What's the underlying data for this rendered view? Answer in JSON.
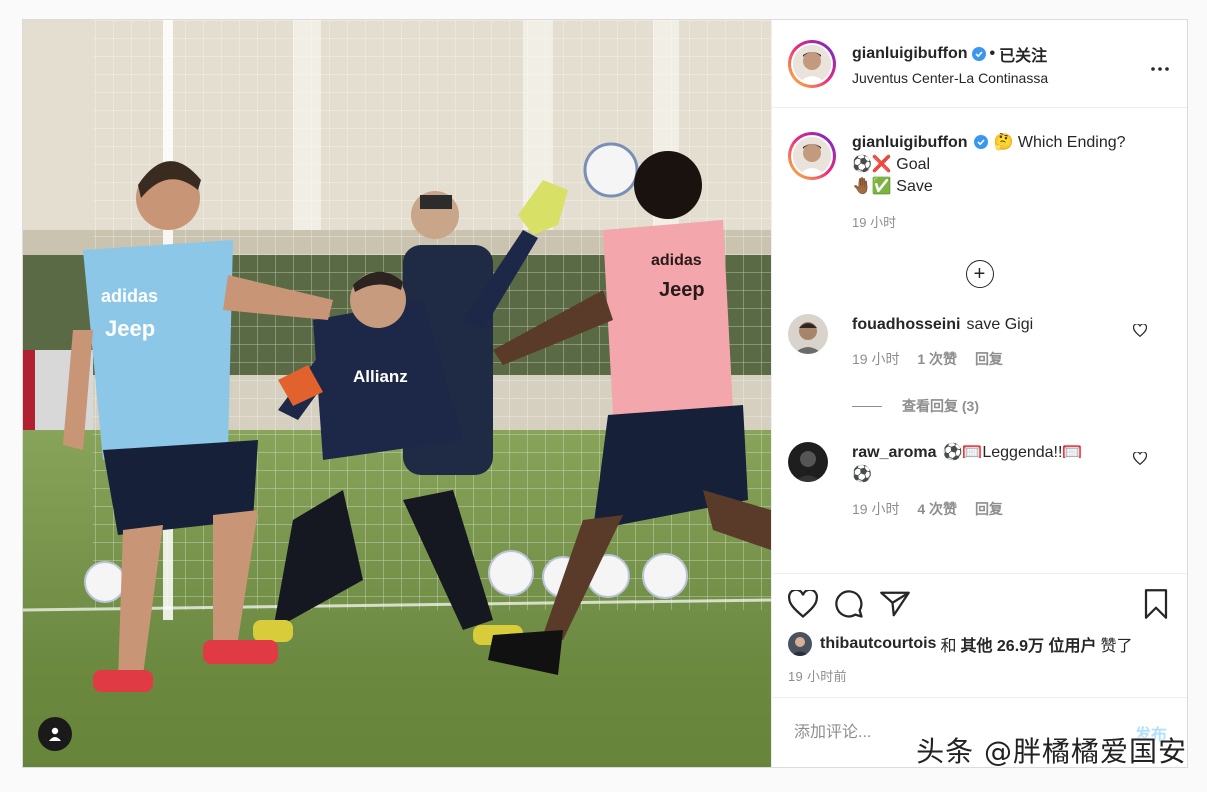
{
  "post": {
    "username": "gianluigibuffon",
    "follow_state": "已关注",
    "location": "Juventus Center-La Continassa",
    "caption": {
      "username": "gianluigibuffon",
      "line1_emoji": "🤔",
      "line1_text": "Which Ending?",
      "line2_emoji": "⚽❌",
      "line2_text": "Goal",
      "line3_emoji": "🤚🏾✅",
      "line3_text": "Save",
      "time": "19 小时"
    },
    "load_more_symbol": "+"
  },
  "comments": [
    {
      "username": "fouadhosseini",
      "text": "save Gigi",
      "time": "19 小时",
      "likes": "1 次赞",
      "reply": "回复"
    },
    {
      "username": "raw_aroma",
      "text": "⚽🥅Leggenda!!🥅",
      "text2": "⚽",
      "time": "19 小时",
      "likes": "4 次赞",
      "reply": "回复"
    }
  ],
  "view_replies": "查看回复 (3)",
  "likes": {
    "user": "thibautcourtois",
    "and": "和",
    "others": "其他 26.9万 位用户",
    "suffix": "赞了"
  },
  "timestamp": "19 小时前",
  "comment_input": {
    "placeholder": "添加评论...",
    "post_label": "发布"
  },
  "watermark": "头条 @胖橘橘爱国安",
  "icons": {
    "like": "heart-icon",
    "comment": "comment-bubble-icon",
    "share": "paper-plane-icon",
    "save": "bookmark-icon",
    "more": "more-dots-icon",
    "verified": "verified-badge-icon",
    "user_tag": "user-tag-icon"
  },
  "colors": {
    "verified": "#3897f0",
    "muted": "#8e8e8e",
    "post_disabled": "#b2dffc"
  }
}
